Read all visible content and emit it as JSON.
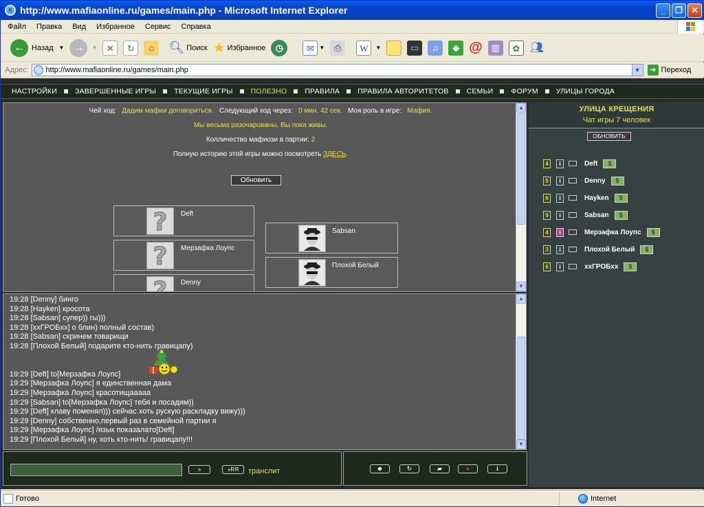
{
  "window": {
    "title": "http://www.mafiaonline.ru/games/main.php - Microsoft Internet Explorer",
    "minimize": "_",
    "maximize": "❐",
    "close": "✕"
  },
  "menu": [
    "Файл",
    "Правка",
    "Вид",
    "Избранное",
    "Сервис",
    "Справка"
  ],
  "toolbar": {
    "back": "Назад",
    "search": "Поиск",
    "favorites": "Избранное"
  },
  "address": {
    "label": "Адрес:",
    "url": "http://www.mafiaonline.ru/games/main.php",
    "go": "Переход"
  },
  "site_nav": [
    "НАСТРОЙКИ",
    "ЗАВЕРШЕННЫЕ ИГРЫ",
    "ТЕКУЩИЕ ИГРЫ",
    "ПОЛЕЗНО",
    "ПРАВИЛА",
    "ПРАВИЛА АВТОРИТЕТОВ",
    "СЕМЬИ",
    "ФОРУМ",
    "УЛИЦЫ ГОРОДА"
  ],
  "game": {
    "turn_label": "Чей ход:",
    "turn_value": "Дадим мафии договориться.",
    "next_label": "Следующий ход через:",
    "next_value": "0 мин. 42 сек.",
    "role_label": "Моя роль в игре:",
    "role_value": "Мафия.",
    "message": "Мы весьма разочарованы, Вы пока живы.",
    "mafia_count_label": "Колличество мафиози в партии:",
    "mafia_count_value": "2",
    "history_text": "Полную историю этой игры можно посмотреть",
    "history_link": "ЗДЕСЬ",
    "history_end": ".",
    "refresh_button": "Обновить"
  },
  "players_left": [
    "Deft",
    "Мерзафка Лоупс",
    "Denny"
  ],
  "players_right": [
    "Sabsan",
    "Плохой Белый"
  ],
  "chat": [
    "19:28 [Denny] бинго",
    "19:28 [Hayken] кросота",
    "19:28 [Sabsan] супер)) гы)))",
    "19:28 [xxГРОБxx] о блин) полный состав)",
    "19:28 [Sabsan] скринем товарищи",
    "19:28 [Плохой Белый] подарите кто-нить гравицапу)",
    "",
    "",
    "19:29 [Deft] to[Мерзафка Лоупс]",
    "19:29 [Мерзафка Лоупс] я единственная дама",
    "19:29 [Мерзафка Лоупс] красотищааааа",
    "19:29 [Sabsan] to[Мерзафка Лоупс] тебя и посадим))",
    "19:29 [Deft] клаву поменял))) сейчас хоть рускую раскладку вижу)))",
    "19:29 [Denny] собственно,первый раз в семейной партии я",
    "19:29 [Мерзафка Лоупс] /язык показалато[Deft]",
    "19:29 [Плохой Белый] ну, хоть кто-нить! гравицапу!!!"
  ],
  "input": {
    "send_button": "»",
    "ru_button": "»RЯ",
    "translit": "транслит"
  },
  "street": {
    "title": "УЛИЦА КРЕЩЕНИЯ",
    "subtitle": "Чат игры 7 человек",
    "refresh_button": "ОБНОВИТЬ",
    "users": [
      {
        "level": "4",
        "name": "Deft",
        "info_highlight": false
      },
      {
        "level": "5",
        "name": "Denny",
        "info_highlight": false
      },
      {
        "level": "6",
        "name": "Hayken",
        "info_highlight": false
      },
      {
        "level": "9",
        "name": "Sabsan",
        "info_highlight": false
      },
      {
        "level": "4",
        "name": "Мерзафка Лоупс",
        "info_highlight": true
      },
      {
        "level": "3",
        "name": "Плохой Белый",
        "info_highlight": false
      },
      {
        "level": "6",
        "name": "xxГРОБxx",
        "info_highlight": false
      }
    ]
  },
  "status": {
    "text": "Готово",
    "zone": "Internet"
  },
  "colors": {
    "accent_yellow": "#e4e04a",
    "panel_gray": "#585858",
    "nav_dark_green": "#1d2a1d",
    "xp_blue": "#0743c9"
  }
}
